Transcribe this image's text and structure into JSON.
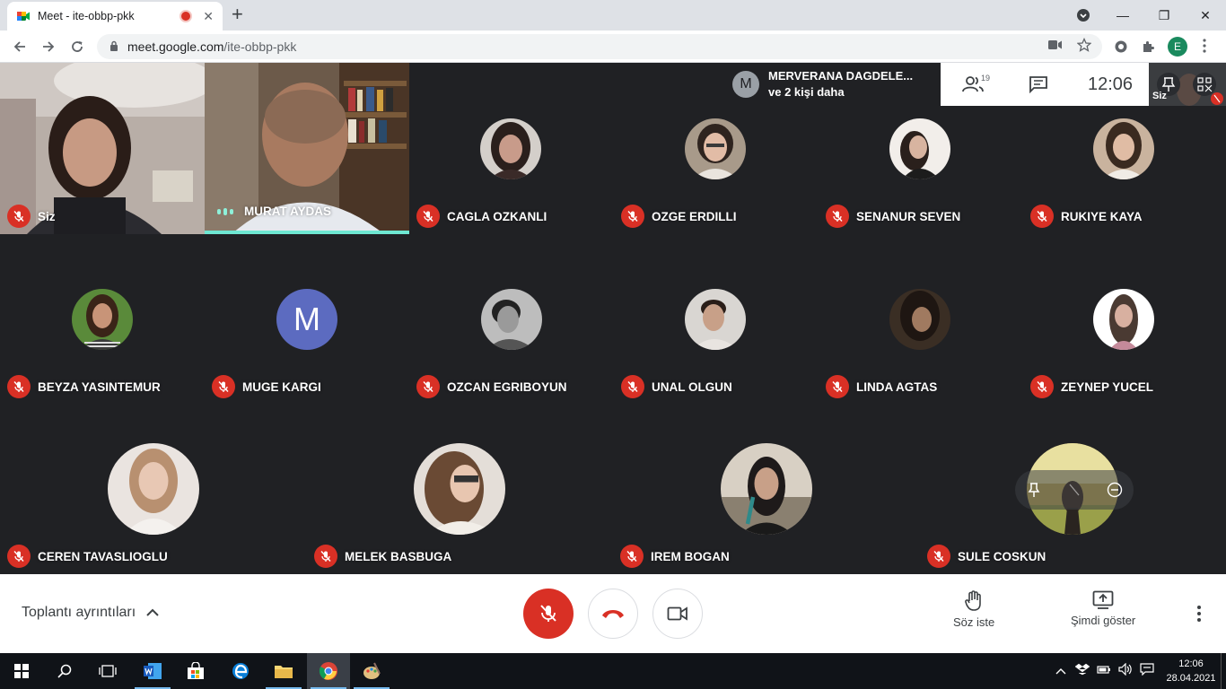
{
  "browser": {
    "tab_title": "Meet - ite-obbp-pkk",
    "tab_close": "✕",
    "new_tab": "+",
    "url_domain": "meet.google.com",
    "url_path": "/ite-obbp-pkk",
    "profile_initial": "E",
    "window_controls": {
      "minimize": "—",
      "maximize": "❐",
      "close": "✕"
    }
  },
  "meeting": {
    "presenter_chip": {
      "initial": "M",
      "line1": "MERVERANA DAGDELE...",
      "line2": "ve 2 kişi daha"
    },
    "people_count": "19",
    "clock": "12:06",
    "self_mini_label": "Siz",
    "participants": [
      {
        "name": "Siz",
        "muted": true,
        "type": "video"
      },
      {
        "name": "MURAT AYDAS",
        "muted": false,
        "type": "video",
        "speaking": true
      },
      {
        "name": "CAGLA OZKANLI",
        "muted": true,
        "type": "photo"
      },
      {
        "name": "OZGE ERDILLI",
        "muted": true,
        "type": "photo"
      },
      {
        "name": "SENANUR SEVEN",
        "muted": true,
        "type": "photo"
      },
      {
        "name": "RUKIYE KAYA",
        "muted": true,
        "type": "photo"
      },
      {
        "name": "BEYZA YASINTEMUR",
        "muted": true,
        "type": "photo"
      },
      {
        "name": "MUGE KARGI",
        "muted": true,
        "type": "letter",
        "initial": "M"
      },
      {
        "name": "OZCAN EGRIBOYUN",
        "muted": true,
        "type": "photo"
      },
      {
        "name": "UNAL OLGUN",
        "muted": true,
        "type": "photo"
      },
      {
        "name": "LINDA AGTAS",
        "muted": true,
        "type": "photo"
      },
      {
        "name": "ZEYNEP YUCEL",
        "muted": true,
        "type": "photo"
      },
      {
        "name": "CEREN TAVASLIOGLU",
        "muted": true,
        "type": "photo"
      },
      {
        "name": "MELEK BASBUGA",
        "muted": true,
        "type": "photo"
      },
      {
        "name": "IREM BOGAN",
        "muted": true,
        "type": "photo"
      },
      {
        "name": "SULE COSKUN",
        "muted": true,
        "type": "photo"
      }
    ]
  },
  "bottom": {
    "meeting_details": "Toplantı ayrıntıları",
    "raise_hand": "Söz iste",
    "present_now": "Şimdi göster"
  },
  "taskbar": {
    "time": "12:06",
    "date": "28.04.2021"
  },
  "colors": {
    "stage_bg": "#202124",
    "mute_red": "#d93025",
    "speaking_accent": "#6ee7d2",
    "letter_avatar": "#5c6bc0"
  }
}
